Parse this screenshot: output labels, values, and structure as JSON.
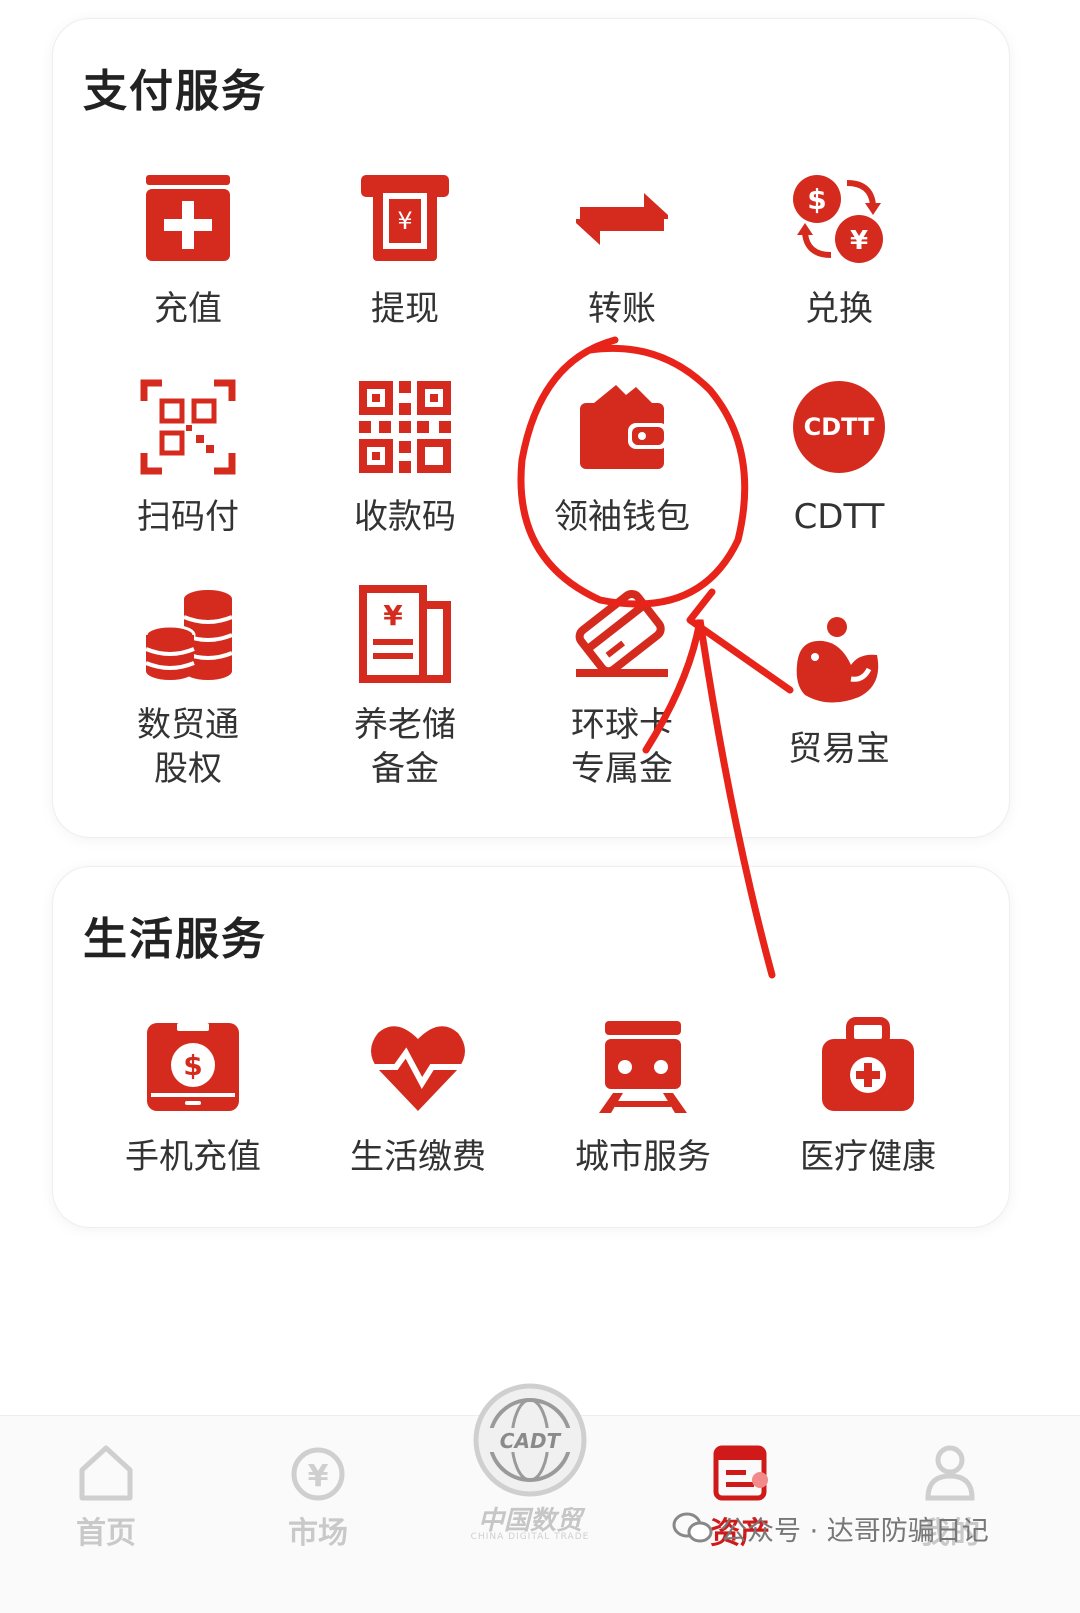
{
  "payment_services": {
    "title": "支付服务",
    "items": [
      {
        "label": "充值",
        "icon": "top-up-icon"
      },
      {
        "label": "提现",
        "icon": "withdraw-icon"
      },
      {
        "label": "转账",
        "icon": "transfer-icon"
      },
      {
        "label": "兑换",
        "icon": "exchange-icon"
      },
      {
        "label": "扫码付",
        "icon": "scan-pay-icon"
      },
      {
        "label": "收款码",
        "icon": "qr-code-icon"
      },
      {
        "label": "领袖钱包",
        "icon": "wallet-icon"
      },
      {
        "label": "CDTT",
        "icon": "cdtt-icon",
        "icon_text": "CDTT"
      },
      {
        "label": "数贸通股权",
        "label_line1": "数贸通",
        "label_line2": "股权",
        "icon": "coins-icon"
      },
      {
        "label": "养老储备金",
        "label_line1": "养老储",
        "label_line2": "备金",
        "icon": "pension-icon"
      },
      {
        "label": "环球卡专属金",
        "label_line1": "环球卡",
        "label_line2": "专属金",
        "icon": "card-icon"
      },
      {
        "label": "贸易宝",
        "icon": "bird-icon"
      }
    ]
  },
  "life_services": {
    "title": "生活服务",
    "items": [
      {
        "label": "手机充值",
        "icon": "phone-top-up-icon"
      },
      {
        "label": "生活缴费",
        "icon": "heart-pulse-icon"
      },
      {
        "label": "城市服务",
        "icon": "train-icon"
      },
      {
        "label": "医疗健康",
        "icon": "medical-kit-icon"
      }
    ]
  },
  "bottom_nav": {
    "items": [
      {
        "label": "首页",
        "icon": "home-icon",
        "active": false
      },
      {
        "label": "市场",
        "icon": "market-icon",
        "active": false
      },
      {
        "label": "资产",
        "icon": "assets-icon",
        "active": true
      },
      {
        "label": "我的",
        "icon": "profile-icon",
        "active": false
      }
    ],
    "center": {
      "logo_text": "CADT",
      "label": "中国数贸",
      "sub": "CHINA DIGITAL TRADE"
    }
  },
  "watermark": {
    "text": "公众号 · 达哥防骗日记"
  },
  "colors": {
    "brand_red": "#d52b1e",
    "annotation_red": "#e8241a",
    "inactive_gray": "#c9c9c9"
  }
}
